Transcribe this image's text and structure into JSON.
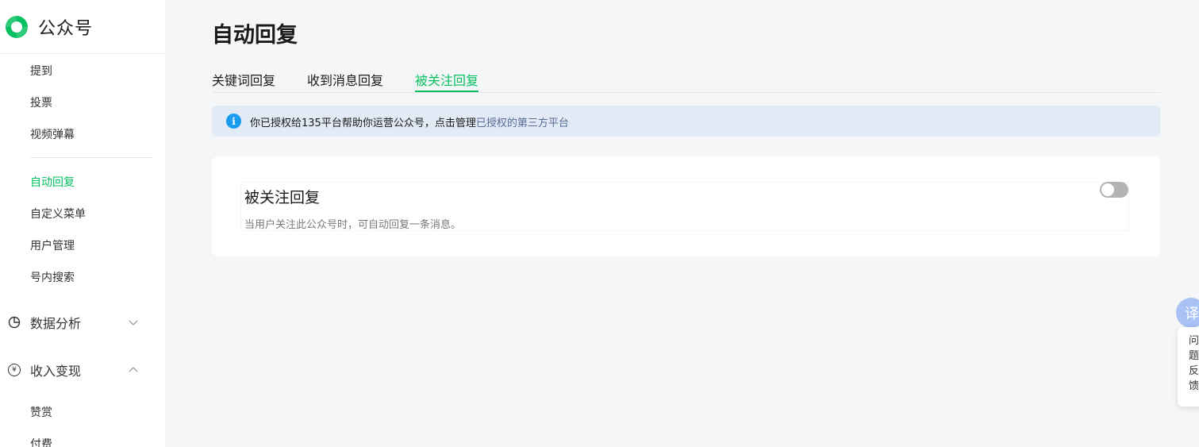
{
  "brand": {
    "name": "公众号",
    "color": "#07c160"
  },
  "sidebar": {
    "items": [
      {
        "label": "提到"
      },
      {
        "label": "投票"
      },
      {
        "label": "视频弹幕"
      },
      {
        "label": "自动回复",
        "active": true
      },
      {
        "label": "自定义菜单"
      },
      {
        "label": "用户管理"
      },
      {
        "label": "号内搜索"
      }
    ],
    "groups": [
      {
        "label": "数据分析",
        "icon": "pie-chart-icon",
        "expanded": false
      },
      {
        "label": "收入变现",
        "icon": "yen-icon",
        "glyph": "¥",
        "expanded": true
      }
    ],
    "sub_items": [
      {
        "label": "赞赏"
      },
      {
        "label": "付费"
      }
    ]
  },
  "page": {
    "title": "自动回复"
  },
  "tabs": [
    {
      "label": "关键词回复"
    },
    {
      "label": "收到消息回复"
    },
    {
      "label": "被关注回复",
      "active": true
    }
  ],
  "notice": {
    "icon": "info-icon",
    "glyph": "i",
    "text": "你已授权给135平台帮助你运营公众号，点击管理",
    "link": "已授权的第三方平台"
  },
  "card": {
    "title": "被关注回复",
    "description": "当用户关注此公众号时，可自动回复一条消息。",
    "toggle_on": false
  },
  "floating": {
    "translate_glyph": "译",
    "feedback_lines": [
      "问",
      "题",
      "反",
      "馈"
    ]
  },
  "colors": {
    "accent": "#07c160",
    "link": "#576b95",
    "notice_bg": "#e1eaf5",
    "info_icon": "#1a9bf0"
  }
}
